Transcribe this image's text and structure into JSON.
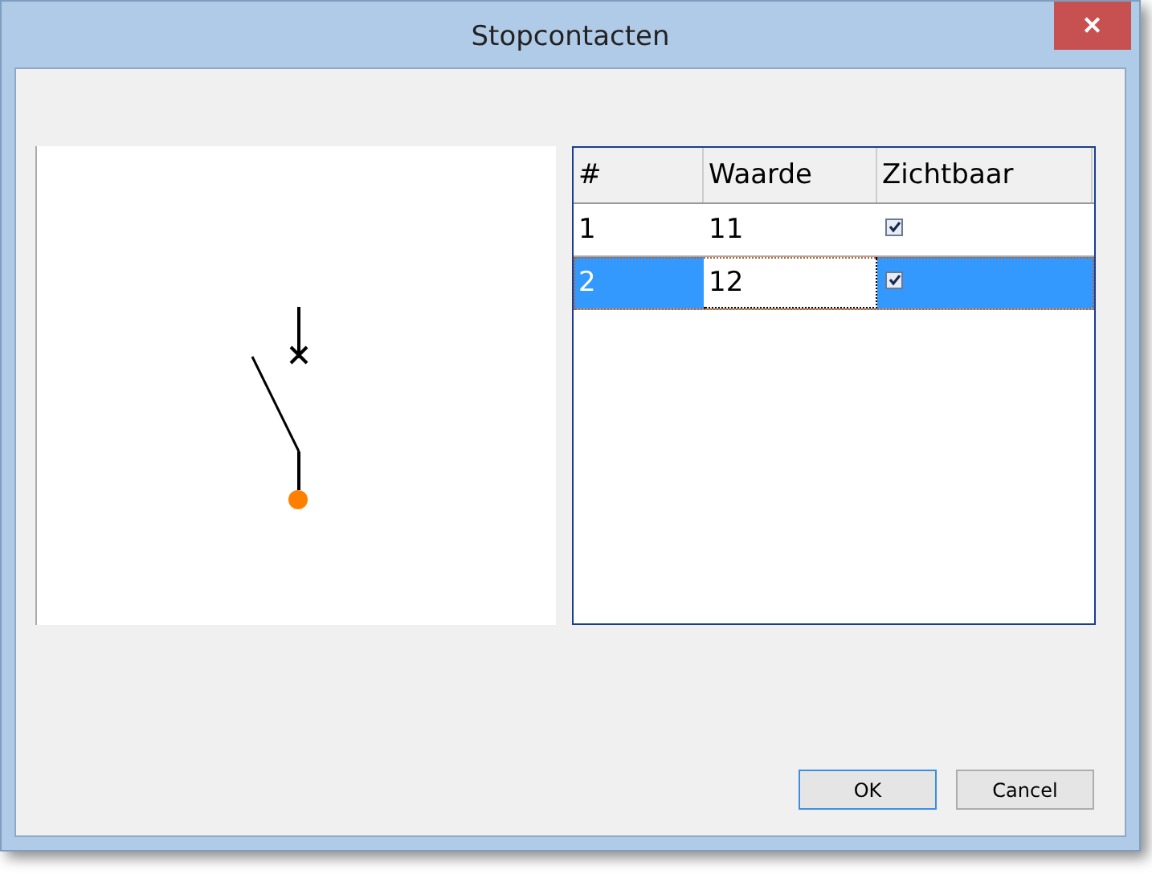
{
  "window": {
    "title": "Stopcontacten",
    "close": "✕"
  },
  "table": {
    "columns": [
      "#",
      "Waarde",
      "Zichtbaar"
    ],
    "rows": [
      {
        "number": "1",
        "value": "11",
        "visible": true,
        "selected": false,
        "editing": false
      },
      {
        "number": "2",
        "value": "12",
        "visible": true,
        "selected": true,
        "editing": true
      }
    ]
  },
  "buttons": [
    {
      "label": "OK",
      "default": true
    },
    {
      "label": "Cancel",
      "default": false
    }
  ]
}
